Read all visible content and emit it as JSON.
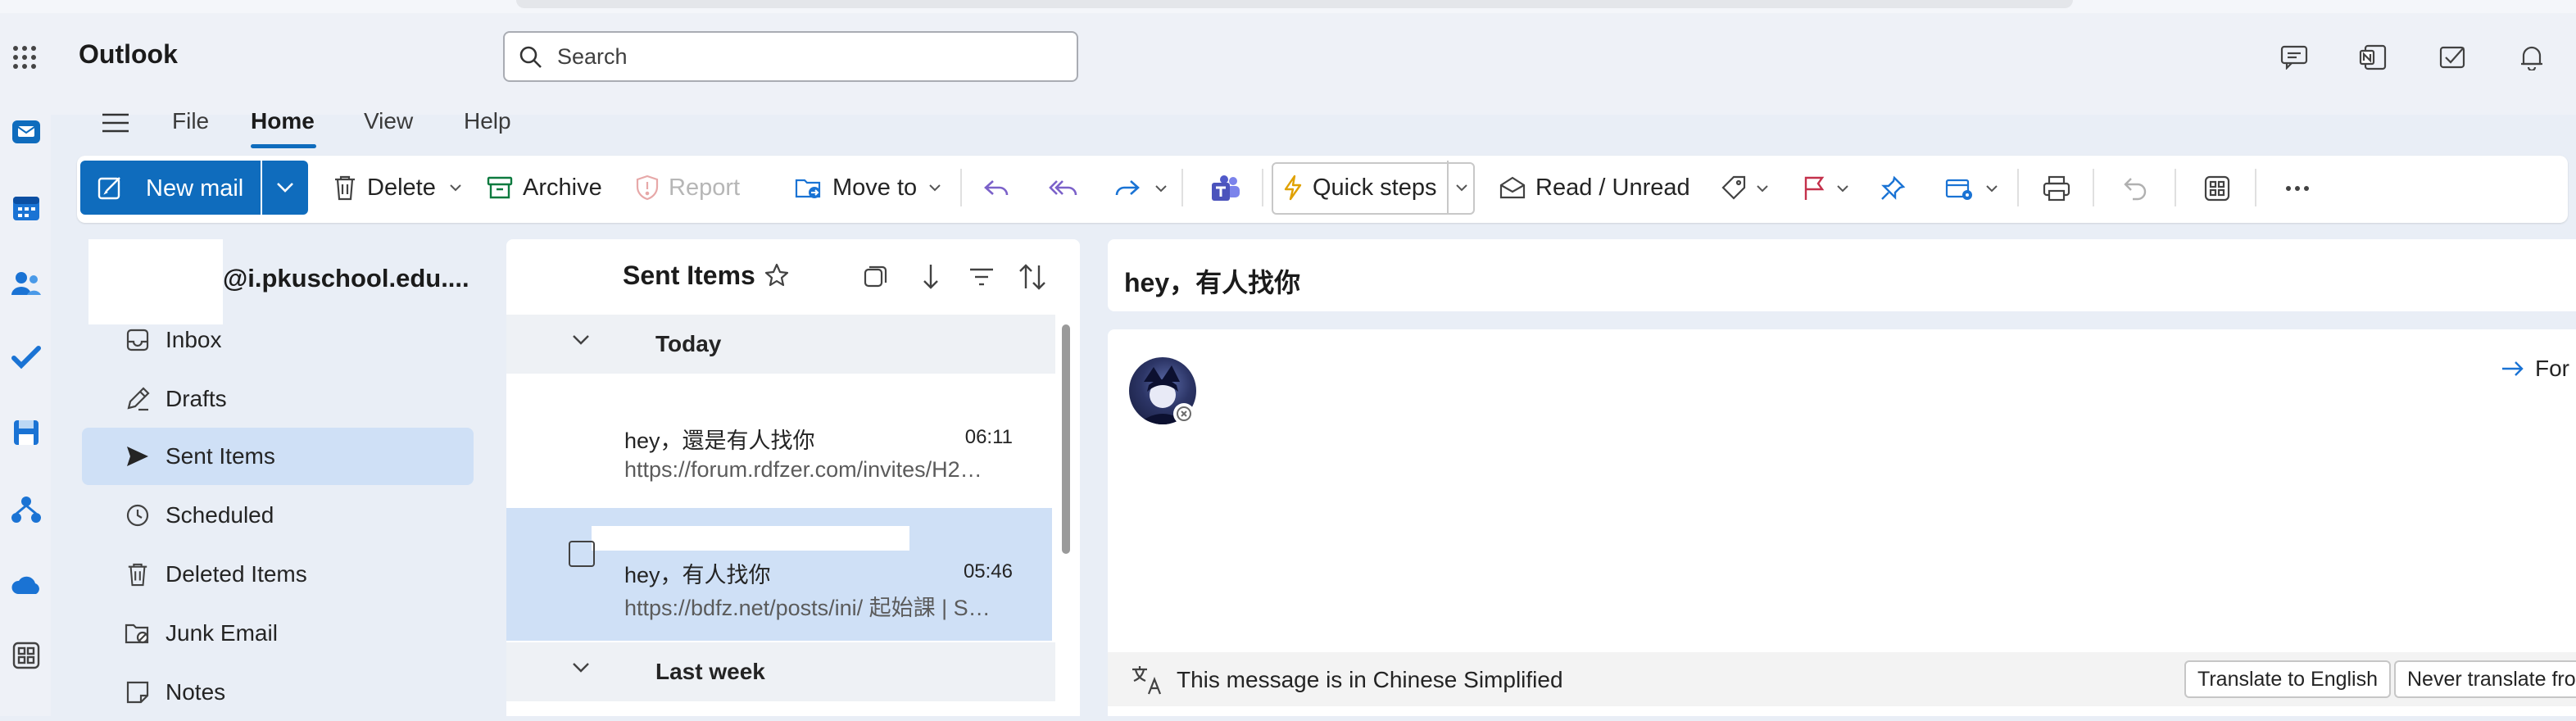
{
  "app": {
    "title": "Outlook"
  },
  "search": {
    "placeholder": "Search"
  },
  "ribbon_tabs": [
    {
      "label": "File"
    },
    {
      "label": "Home"
    },
    {
      "label": "View"
    },
    {
      "label": "Help"
    }
  ],
  "ribbon": {
    "new_mail": "New mail",
    "delete": "Delete",
    "archive": "Archive",
    "report": "Report",
    "move_to": "Move to",
    "quick_steps": "Quick steps",
    "read_unread": "Read / Unread"
  },
  "folders": {
    "account": "@i.pkuschool.edu....",
    "items": [
      {
        "label": "Inbox",
        "icon": "inbox-icon"
      },
      {
        "label": "Drafts",
        "icon": "pencil-icon"
      },
      {
        "label": "Sent Items",
        "icon": "send-icon",
        "selected": true
      },
      {
        "label": "Scheduled",
        "icon": "clock-icon"
      },
      {
        "label": "Deleted Items",
        "icon": "trash-icon"
      },
      {
        "label": "Junk Email",
        "icon": "junk-icon"
      },
      {
        "label": "Notes",
        "icon": "note-icon"
      }
    ]
  },
  "message_list": {
    "title": "Sent Items",
    "groups": {
      "today": "Today",
      "last_week": "Last week"
    },
    "messages": [
      {
        "subject": "hey，還是有人找你",
        "time": "06:11",
        "preview": "https://forum.rdfzer.com/invites/H2…"
      },
      {
        "subject": "hey，有人找你",
        "time": "05:46",
        "preview": "https://bdfz.net/posts/ini/ 起始課 | S…",
        "selected": true
      }
    ]
  },
  "reading": {
    "subject": "hey，有人找你",
    "forward": "For",
    "translate_notice": "This message is in Chinese Simplified",
    "translate_button": "Translate to English",
    "never_translate_button": "Never translate fro"
  },
  "colors": {
    "accent": "#0f6cbd",
    "selected": "#cfe0f6",
    "flag": "#c4314b"
  }
}
